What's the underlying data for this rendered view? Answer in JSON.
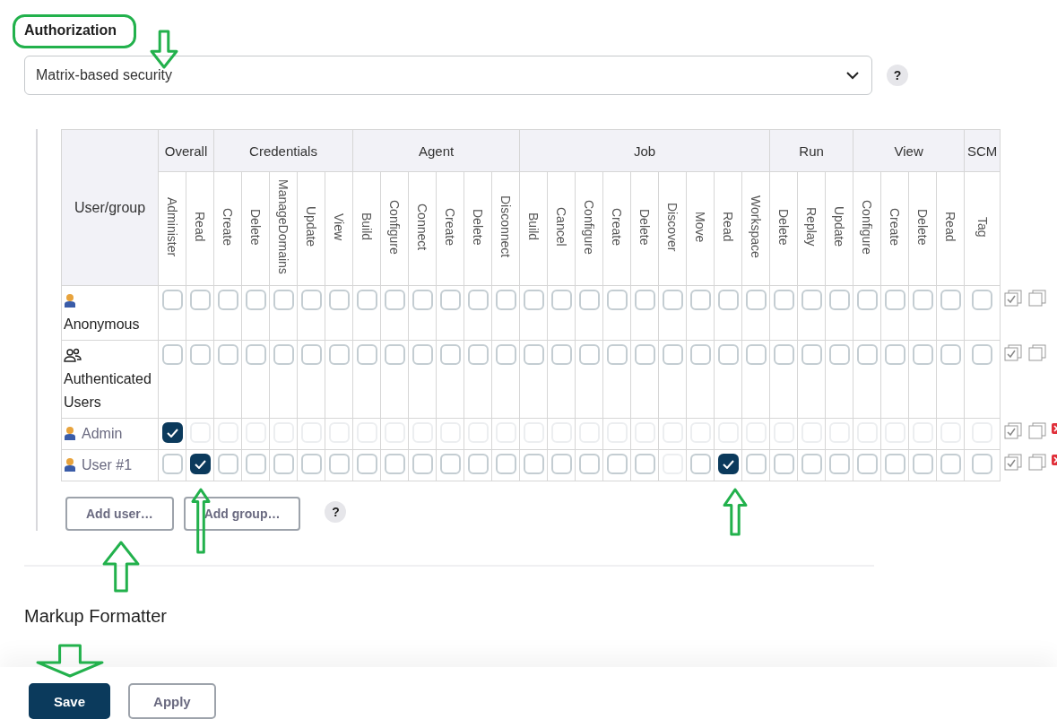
{
  "authorization": {
    "heading": "Authorization",
    "strategy": "Matrix-based security",
    "help": "?"
  },
  "matrix": {
    "user_header": "User/group",
    "groups": [
      {
        "name": "Overall",
        "permissions": [
          "Administer",
          "Read"
        ]
      },
      {
        "name": "Credentials",
        "permissions": [
          "Create",
          "Delete",
          "ManageDomains",
          "Update",
          "View"
        ]
      },
      {
        "name": "Agent",
        "permissions": [
          "Build",
          "Configure",
          "Connect",
          "Create",
          "Delete",
          "Disconnect"
        ]
      },
      {
        "name": "Job",
        "permissions": [
          "Build",
          "Cancel",
          "Configure",
          "Create",
          "Delete",
          "Discover",
          "Move",
          "Read",
          "Workspace"
        ]
      },
      {
        "name": "Run",
        "permissions": [
          "Delete",
          "Replay",
          "Update"
        ]
      },
      {
        "name": "View",
        "permissions": [
          "Configure",
          "Create",
          "Delete",
          "Read"
        ]
      },
      {
        "name": "SCM",
        "permissions": [
          "Tag"
        ]
      }
    ],
    "rows": [
      {
        "name": "Anonymous",
        "kind": "builtin-user",
        "removable": false,
        "cells": [
          {
            "checked": false,
            "disabled": false
          },
          {
            "checked": false,
            "disabled": false
          },
          {
            "checked": false,
            "disabled": false
          },
          {
            "checked": false,
            "disabled": false
          },
          {
            "checked": false,
            "disabled": false
          },
          {
            "checked": false,
            "disabled": false
          },
          {
            "checked": false,
            "disabled": false
          },
          {
            "checked": false,
            "disabled": false
          },
          {
            "checked": false,
            "disabled": false
          },
          {
            "checked": false,
            "disabled": false
          },
          {
            "checked": false,
            "disabled": false
          },
          {
            "checked": false,
            "disabled": false
          },
          {
            "checked": false,
            "disabled": false
          },
          {
            "checked": false,
            "disabled": false
          },
          {
            "checked": false,
            "disabled": false
          },
          {
            "checked": false,
            "disabled": false
          },
          {
            "checked": false,
            "disabled": false
          },
          {
            "checked": false,
            "disabled": false
          },
          {
            "checked": false,
            "disabled": false
          },
          {
            "checked": false,
            "disabled": false
          },
          {
            "checked": false,
            "disabled": false
          },
          {
            "checked": false,
            "disabled": false
          },
          {
            "checked": false,
            "disabled": false
          },
          {
            "checked": false,
            "disabled": false
          },
          {
            "checked": false,
            "disabled": false
          },
          {
            "checked": false,
            "disabled": false
          },
          {
            "checked": false,
            "disabled": false
          },
          {
            "checked": false,
            "disabled": false
          },
          {
            "checked": false,
            "disabled": false
          },
          {
            "checked": false,
            "disabled": false
          }
        ]
      },
      {
        "name": "Authenticated Users",
        "kind": "builtin-group",
        "removable": false,
        "cells": [
          {
            "checked": false,
            "disabled": false
          },
          {
            "checked": false,
            "disabled": false
          },
          {
            "checked": false,
            "disabled": false
          },
          {
            "checked": false,
            "disabled": false
          },
          {
            "checked": false,
            "disabled": false
          },
          {
            "checked": false,
            "disabled": false
          },
          {
            "checked": false,
            "disabled": false
          },
          {
            "checked": false,
            "disabled": false
          },
          {
            "checked": false,
            "disabled": false
          },
          {
            "checked": false,
            "disabled": false
          },
          {
            "checked": false,
            "disabled": false
          },
          {
            "checked": false,
            "disabled": false
          },
          {
            "checked": false,
            "disabled": false
          },
          {
            "checked": false,
            "disabled": false
          },
          {
            "checked": false,
            "disabled": false
          },
          {
            "checked": false,
            "disabled": false
          },
          {
            "checked": false,
            "disabled": false
          },
          {
            "checked": false,
            "disabled": false
          },
          {
            "checked": false,
            "disabled": false
          },
          {
            "checked": false,
            "disabled": false
          },
          {
            "checked": false,
            "disabled": false
          },
          {
            "checked": false,
            "disabled": false
          },
          {
            "checked": false,
            "disabled": false
          },
          {
            "checked": false,
            "disabled": false
          },
          {
            "checked": false,
            "disabled": false
          },
          {
            "checked": false,
            "disabled": false
          },
          {
            "checked": false,
            "disabled": false
          },
          {
            "checked": false,
            "disabled": false
          },
          {
            "checked": false,
            "disabled": false
          },
          {
            "checked": false,
            "disabled": false
          }
        ]
      },
      {
        "name": "Admin",
        "kind": "user",
        "removable": true,
        "cells": [
          {
            "checked": true,
            "disabled": false
          },
          {
            "checked": false,
            "disabled": true
          },
          {
            "checked": false,
            "disabled": true
          },
          {
            "checked": false,
            "disabled": true
          },
          {
            "checked": false,
            "disabled": true
          },
          {
            "checked": false,
            "disabled": true
          },
          {
            "checked": false,
            "disabled": true
          },
          {
            "checked": false,
            "disabled": true
          },
          {
            "checked": false,
            "disabled": true
          },
          {
            "checked": false,
            "disabled": true
          },
          {
            "checked": false,
            "disabled": true
          },
          {
            "checked": false,
            "disabled": true
          },
          {
            "checked": false,
            "disabled": true
          },
          {
            "checked": false,
            "disabled": true
          },
          {
            "checked": false,
            "disabled": true
          },
          {
            "checked": false,
            "disabled": true
          },
          {
            "checked": false,
            "disabled": true
          },
          {
            "checked": false,
            "disabled": true
          },
          {
            "checked": false,
            "disabled": true
          },
          {
            "checked": false,
            "disabled": true
          },
          {
            "checked": false,
            "disabled": true
          },
          {
            "checked": false,
            "disabled": true
          },
          {
            "checked": false,
            "disabled": true
          },
          {
            "checked": false,
            "disabled": true
          },
          {
            "checked": false,
            "disabled": true
          },
          {
            "checked": false,
            "disabled": true
          },
          {
            "checked": false,
            "disabled": true
          },
          {
            "checked": false,
            "disabled": true
          },
          {
            "checked": false,
            "disabled": true
          },
          {
            "checked": false,
            "disabled": true
          }
        ]
      },
      {
        "name": "User #1",
        "kind": "user",
        "removable": true,
        "cells": [
          {
            "checked": false,
            "disabled": false
          },
          {
            "checked": true,
            "disabled": false
          },
          {
            "checked": false,
            "disabled": false
          },
          {
            "checked": false,
            "disabled": false
          },
          {
            "checked": false,
            "disabled": false
          },
          {
            "checked": false,
            "disabled": false
          },
          {
            "checked": false,
            "disabled": false
          },
          {
            "checked": false,
            "disabled": false
          },
          {
            "checked": false,
            "disabled": false
          },
          {
            "checked": false,
            "disabled": false
          },
          {
            "checked": false,
            "disabled": false
          },
          {
            "checked": false,
            "disabled": false
          },
          {
            "checked": false,
            "disabled": false
          },
          {
            "checked": false,
            "disabled": false
          },
          {
            "checked": false,
            "disabled": false
          },
          {
            "checked": false,
            "disabled": false
          },
          {
            "checked": false,
            "disabled": false
          },
          {
            "checked": false,
            "disabled": false
          },
          {
            "checked": false,
            "disabled": true
          },
          {
            "checked": false,
            "disabled": false
          },
          {
            "checked": true,
            "disabled": false
          },
          {
            "checked": false,
            "disabled": false
          },
          {
            "checked": false,
            "disabled": false
          },
          {
            "checked": false,
            "disabled": false
          },
          {
            "checked": false,
            "disabled": false
          },
          {
            "checked": false,
            "disabled": false
          },
          {
            "checked": false,
            "disabled": false
          },
          {
            "checked": false,
            "disabled": false
          },
          {
            "checked": false,
            "disabled": false
          },
          {
            "checked": false,
            "disabled": false
          }
        ]
      }
    ],
    "buttons": [
      "Add user…",
      "Add group…"
    ],
    "help": "?"
  },
  "markup_heading": "Markup Formatter",
  "footer_buttons": [
    {
      "label": "Save",
      "primary": true
    },
    {
      "label": "Apply",
      "primary": false
    }
  ]
}
